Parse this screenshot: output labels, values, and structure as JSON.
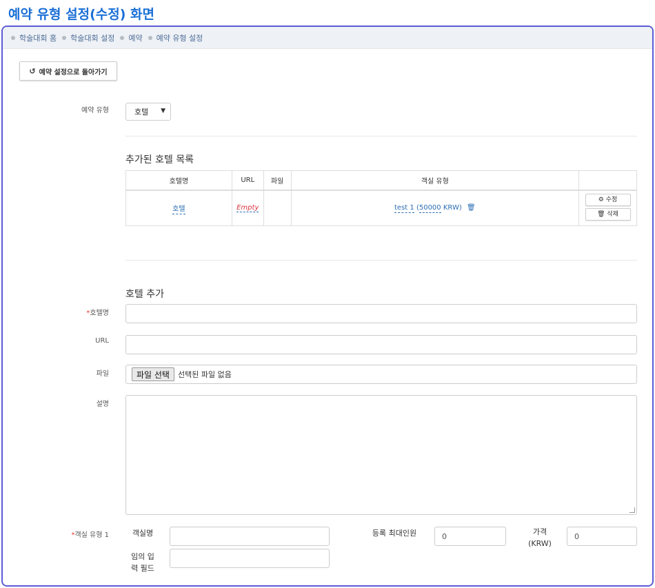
{
  "page": {
    "title": "예약 유형 설정(수정) 화면"
  },
  "breadcrumb": [
    "학술대회 홈",
    "학술대회 설정",
    "예약",
    "예약 유형 설정"
  ],
  "back_button": {
    "label": "예약 설정으로 돌아가기"
  },
  "type_field": {
    "label": "예약 유형",
    "value": "호텔"
  },
  "hotel_list": {
    "title": "추가된 호텔 목록",
    "columns": [
      "호텔명",
      "URL",
      "파일",
      "객실 유형",
      ""
    ],
    "rows": [
      {
        "name": "호텔",
        "url": "Empty",
        "file": "",
        "room_name": "test 1",
        "room_price": "50000",
        "room_currency": "KRW",
        "edit_label": "수정",
        "delete_label": "삭제"
      }
    ]
  },
  "add_hotel": {
    "title": "호텔 추가",
    "name_label": "호텔명",
    "url_label": "URL",
    "file_label": "파일",
    "file_button": "파일 선택",
    "file_status": "선택된 파일 없음",
    "desc_label": "설명",
    "room_type_label": "객실 유형 1",
    "room_name_label": "객실명",
    "max_people_label": "등록 최대인원",
    "max_people_value": "0",
    "price_label": "가격",
    "price_unit": "(KRW)",
    "price_value": "0",
    "custom_field_label_1": "임의 입",
    "custom_field_label_2": "력 필드"
  }
}
